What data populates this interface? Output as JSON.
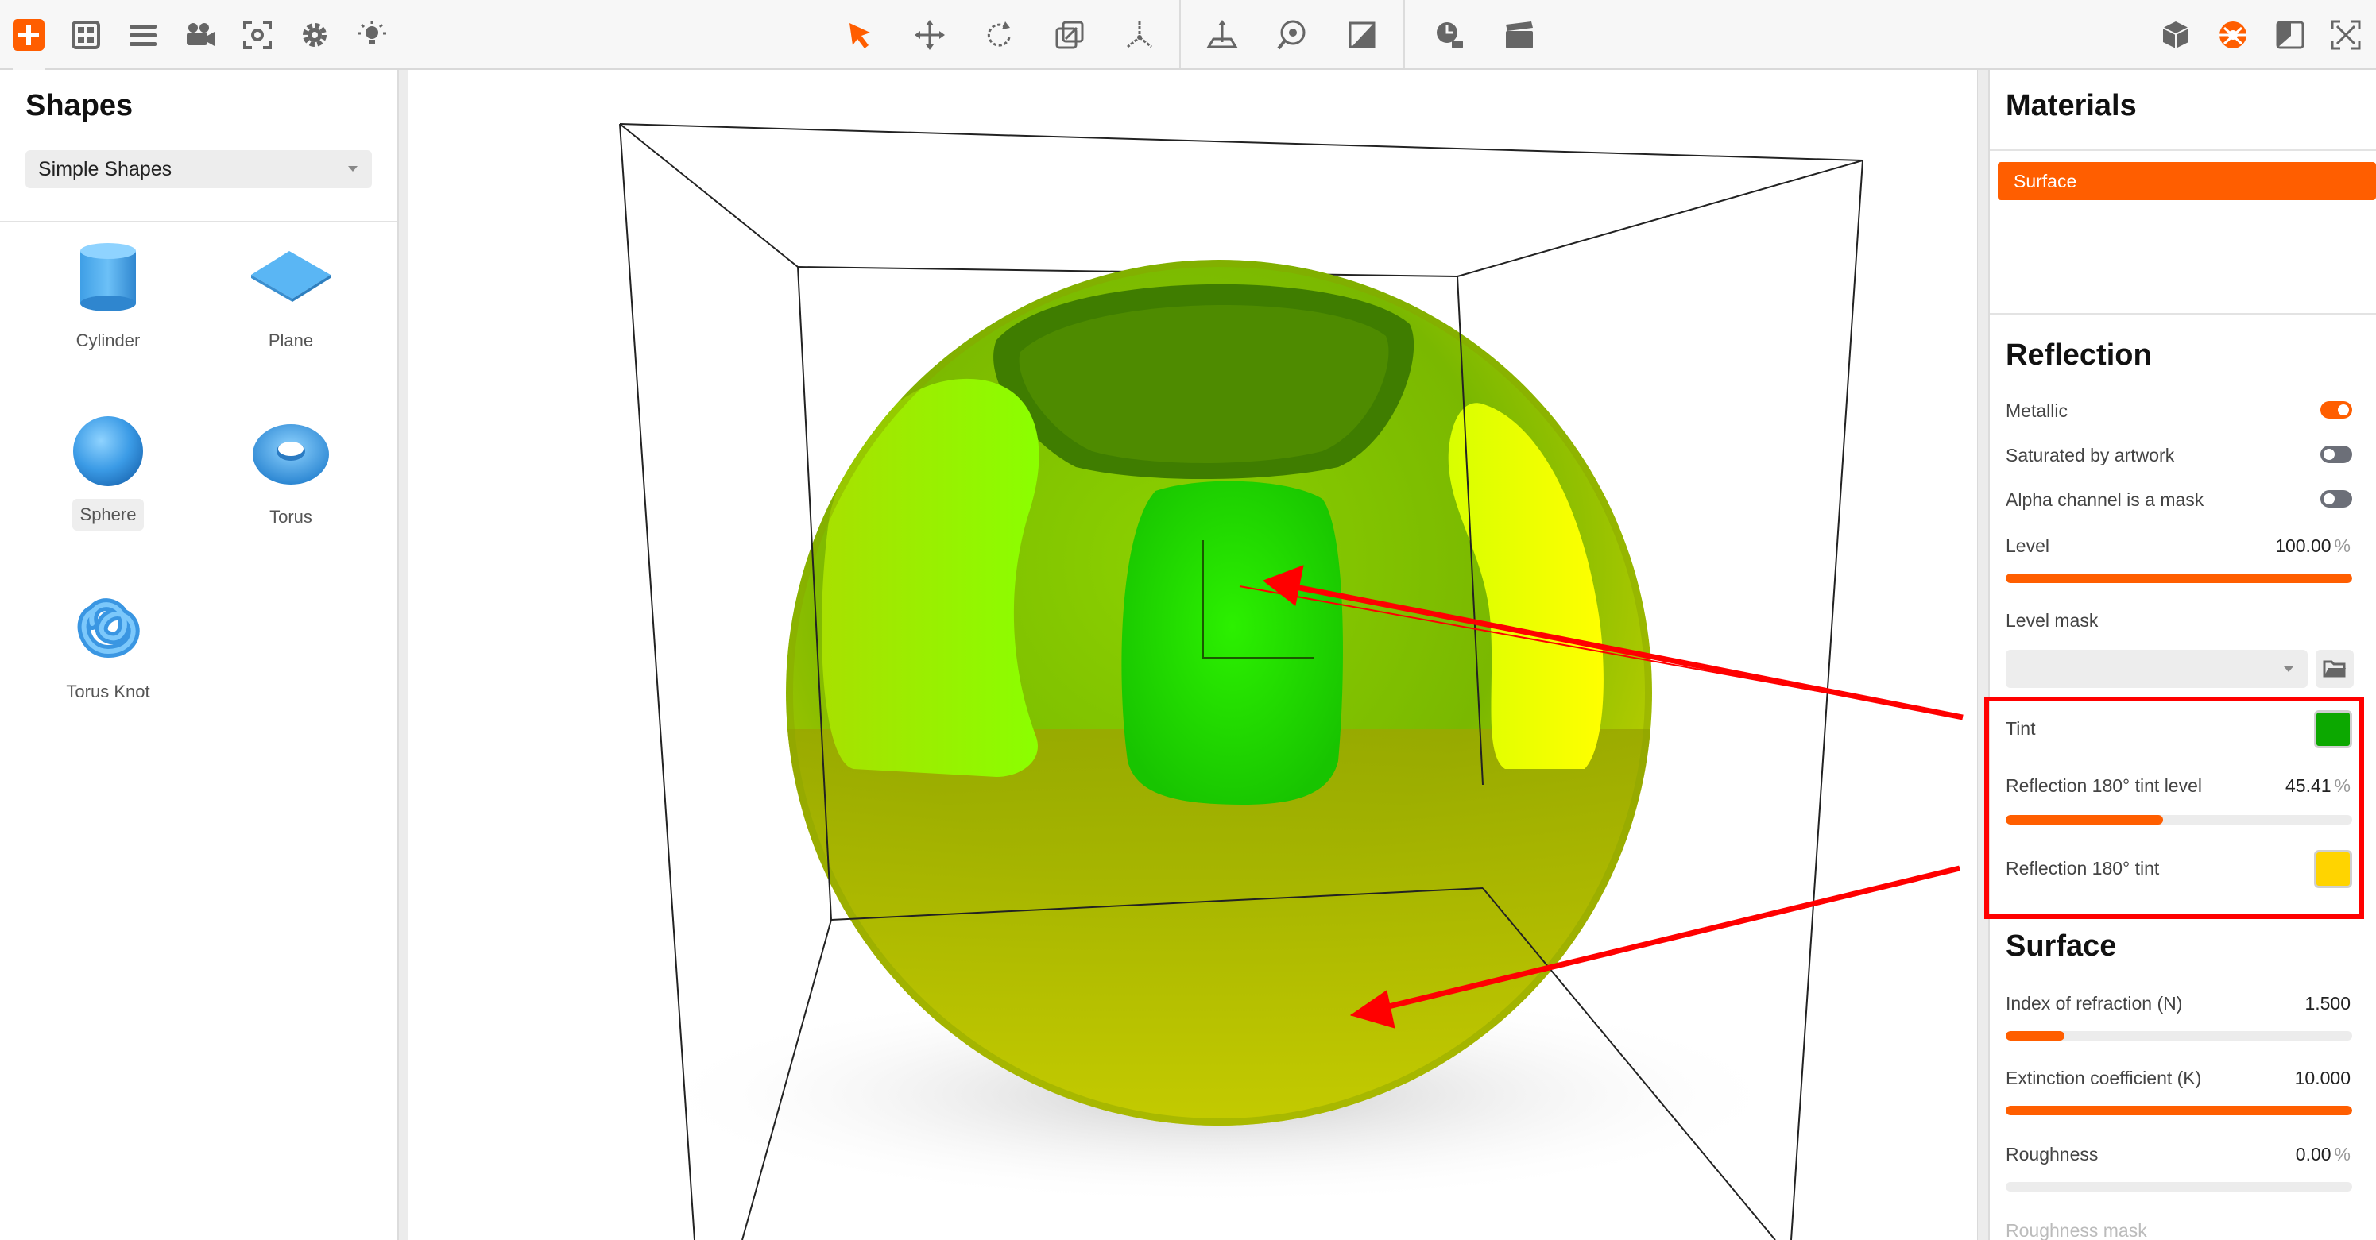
{
  "toolbar": {
    "left_icons": [
      "add-icon",
      "layout-grid-icon",
      "menu-icon",
      "camera-icon",
      "focus-icon",
      "gear-icon",
      "light-icon"
    ],
    "center_icons": [
      "select-arrow-icon",
      "move-icon",
      "rotate-icon",
      "scale-icon",
      "pivot-icon",
      "ground-plane-icon",
      "environment-icon",
      "backplate-icon",
      "render-icon",
      "animation-icon"
    ],
    "right_icons": [
      "cube-icon",
      "materials-icon",
      "panel-icon",
      "fullscreen-icon"
    ],
    "accent_color": "#ff5e00"
  },
  "left_panel": {
    "title": "Shapes",
    "category_select": "Simple Shapes",
    "shapes": [
      {
        "label": "Cylinder",
        "icon": "cylinder-icon"
      },
      {
        "label": "Plane",
        "icon": "plane-icon"
      },
      {
        "label": "Sphere",
        "icon": "sphere-icon",
        "selected": true
      },
      {
        "label": "Torus",
        "icon": "torus-icon"
      },
      {
        "label": "Torus Knot",
        "icon": "torus-knot-icon"
      }
    ]
  },
  "right_panel": {
    "materials_title": "Materials",
    "material_item": "Surface",
    "reflection": {
      "title": "Reflection",
      "metallic_label": "Metallic",
      "metallic_on": true,
      "saturated_label": "Saturated by artwork",
      "saturated_on": false,
      "alpha_label": "Alpha channel is a mask",
      "alpha_on": false,
      "level_label": "Level",
      "level_value": "100.00",
      "level_unit": "%",
      "level_fraction": 1.0,
      "level_mask_label": "Level mask",
      "level_mask_value": "",
      "tint_label": "Tint",
      "tint_color": "#0ca800",
      "tint180_level_label": "Reflection 180° tint level",
      "tint180_level_value": "45.41",
      "tint180_level_unit": "%",
      "tint180_level_fraction": 0.4541,
      "tint180_label": "Reflection 180° tint",
      "tint180_color": "#ffd400"
    },
    "surface": {
      "title": "Surface",
      "ior_label": "Index of refraction (N)",
      "ior_value": "1.500",
      "ior_fraction": 0.17,
      "extinction_label": "Extinction coefficient (K)",
      "extinction_value": "10.000",
      "extinction_fraction": 1.0,
      "roughness_label": "Roughness",
      "roughness_value": "0.00",
      "roughness_unit": "%",
      "roughness_fraction": 0.0,
      "roughness_mask_label": "Roughness mask"
    }
  },
  "annotation_color": "#ff0000"
}
